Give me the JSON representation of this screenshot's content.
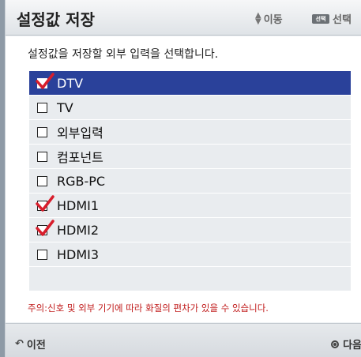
{
  "dialog": {
    "title": "설정값 저장",
    "hint_move": "이동",
    "hint_select_key": "선택",
    "hint_select": "선택",
    "instruction": "설정값을 저장할 외부 입력을 선택합니다.",
    "items": [
      {
        "label": "DTV",
        "checked": true,
        "selected": true
      },
      {
        "label": "TV",
        "checked": false,
        "selected": false
      },
      {
        "label": "외부입력",
        "checked": false,
        "selected": false
      },
      {
        "label": "컴포넌트",
        "checked": false,
        "selected": false
      },
      {
        "label": "RGB-PC",
        "checked": false,
        "selected": false
      },
      {
        "label": "HDMI1",
        "checked": true,
        "selected": false
      },
      {
        "label": "HDMI2",
        "checked": true,
        "selected": false
      },
      {
        "label": "HDMI3",
        "checked": false,
        "selected": false
      }
    ],
    "note": "주의:신호 및 외부 기기에 따라 화질의 편차가 있을 수 있습니다.",
    "footer_prev": "이전",
    "footer_next": "다음",
    "colors": {
      "selected": "#2a419a",
      "check": "#d81e2c",
      "note": "#c01a1a"
    }
  }
}
